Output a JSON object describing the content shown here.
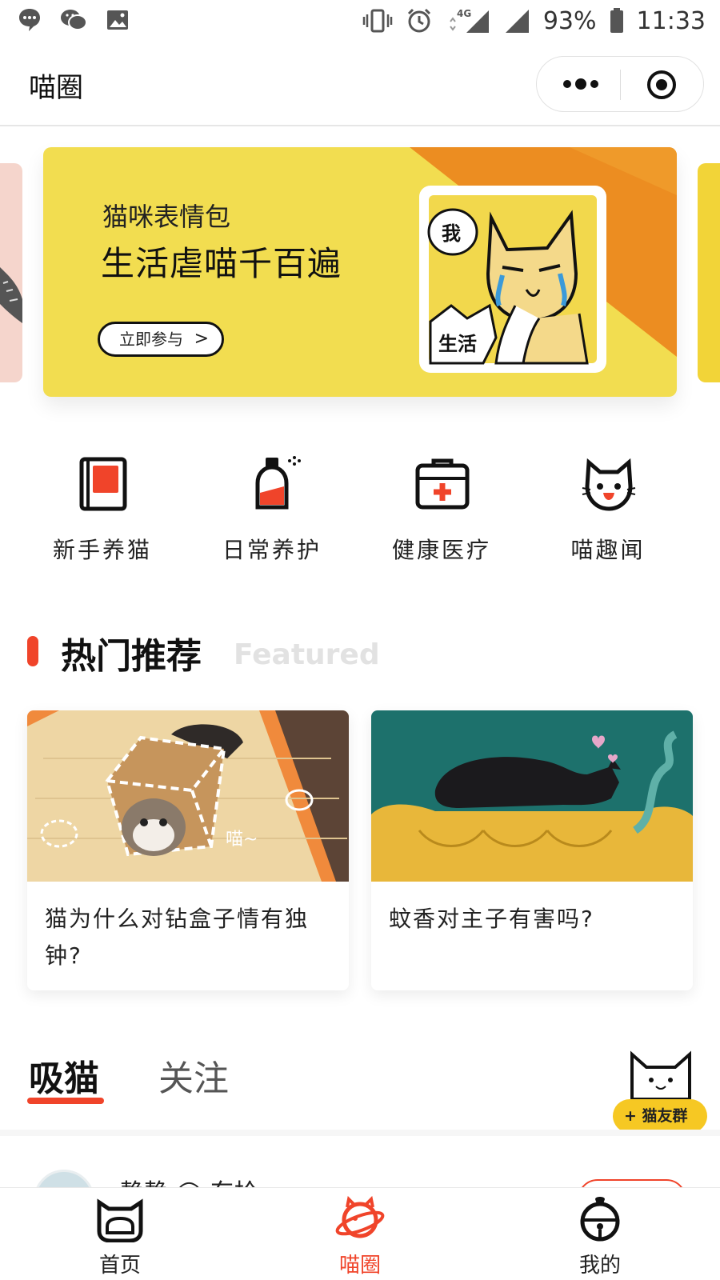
{
  "status_bar": {
    "battery": "93%",
    "time": "11:33",
    "network": "4G"
  },
  "header": {
    "title": "喵圈"
  },
  "banner": {
    "line1": "猫咪表情包",
    "line2": "生活虐喵千百遍",
    "button": "立即参与",
    "bubble_text": "我",
    "sticker_text": "生活"
  },
  "categories": [
    {
      "label": "新手养猫",
      "icon": "book-icon"
    },
    {
      "label": "日常养护",
      "icon": "spray-bottle-icon"
    },
    {
      "label": "健康医疗",
      "icon": "medical-kit-icon"
    },
    {
      "label": "喵趣闻",
      "icon": "cat-face-icon"
    }
  ],
  "featured": {
    "title": "热门推荐",
    "subtitle": "Featured",
    "cards": [
      {
        "title": "猫为什么对钻盒子情有独钟?",
        "image_text": "喵~"
      },
      {
        "title": "蚊香对主子有害吗?"
      }
    ]
  },
  "tabs": {
    "active": "吸猫",
    "inactive": "关注"
  },
  "group_button": "+ 猫友群",
  "feed": {
    "first_user": "静静 ◯ 东拾"
  },
  "bottom_nav": [
    {
      "label": "首页",
      "icon": "home-cat-icon"
    },
    {
      "label": "喵圈",
      "icon": "planet-cat-icon"
    },
    {
      "label": "我的",
      "icon": "bell-icon"
    }
  ],
  "colors": {
    "accent": "#f0442a",
    "banner_yellow": "#f2dd50",
    "banner_orange": "#ec8d21",
    "badge_yellow": "#f6c823"
  }
}
